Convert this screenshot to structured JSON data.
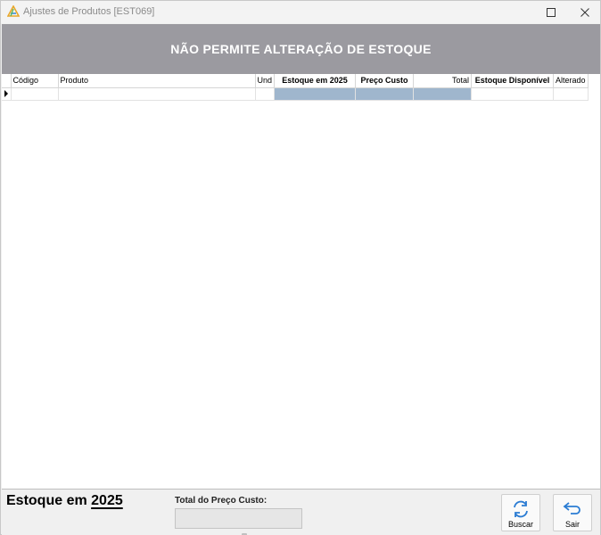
{
  "window": {
    "title": "Ajustes de Produtos [EST069]"
  },
  "banner": {
    "text": "NÃO PERMITE ALTERAÇÃO DE ESTOQUE"
  },
  "grid": {
    "columns": [
      {
        "label": "Código"
      },
      {
        "label": "Produto"
      },
      {
        "label": "Und"
      },
      {
        "label": "Estoque em 2025"
      },
      {
        "label": "Preço Custo"
      },
      {
        "label": "Total"
      },
      {
        "label": "Estoque Disponível"
      },
      {
        "label": "Alterado"
      }
    ]
  },
  "footer": {
    "stock_prefix": "Estoque em ",
    "stock_year": "2025",
    "total_label": "Total do Preço Custo:",
    "total_value": "",
    "buscar_label": "Buscar",
    "sair_label": "Sair"
  },
  "colors": {
    "banner": "#9b9aa0",
    "highlight_cells": "#9fb6cd",
    "accent_icon": "#2b7cd3"
  }
}
